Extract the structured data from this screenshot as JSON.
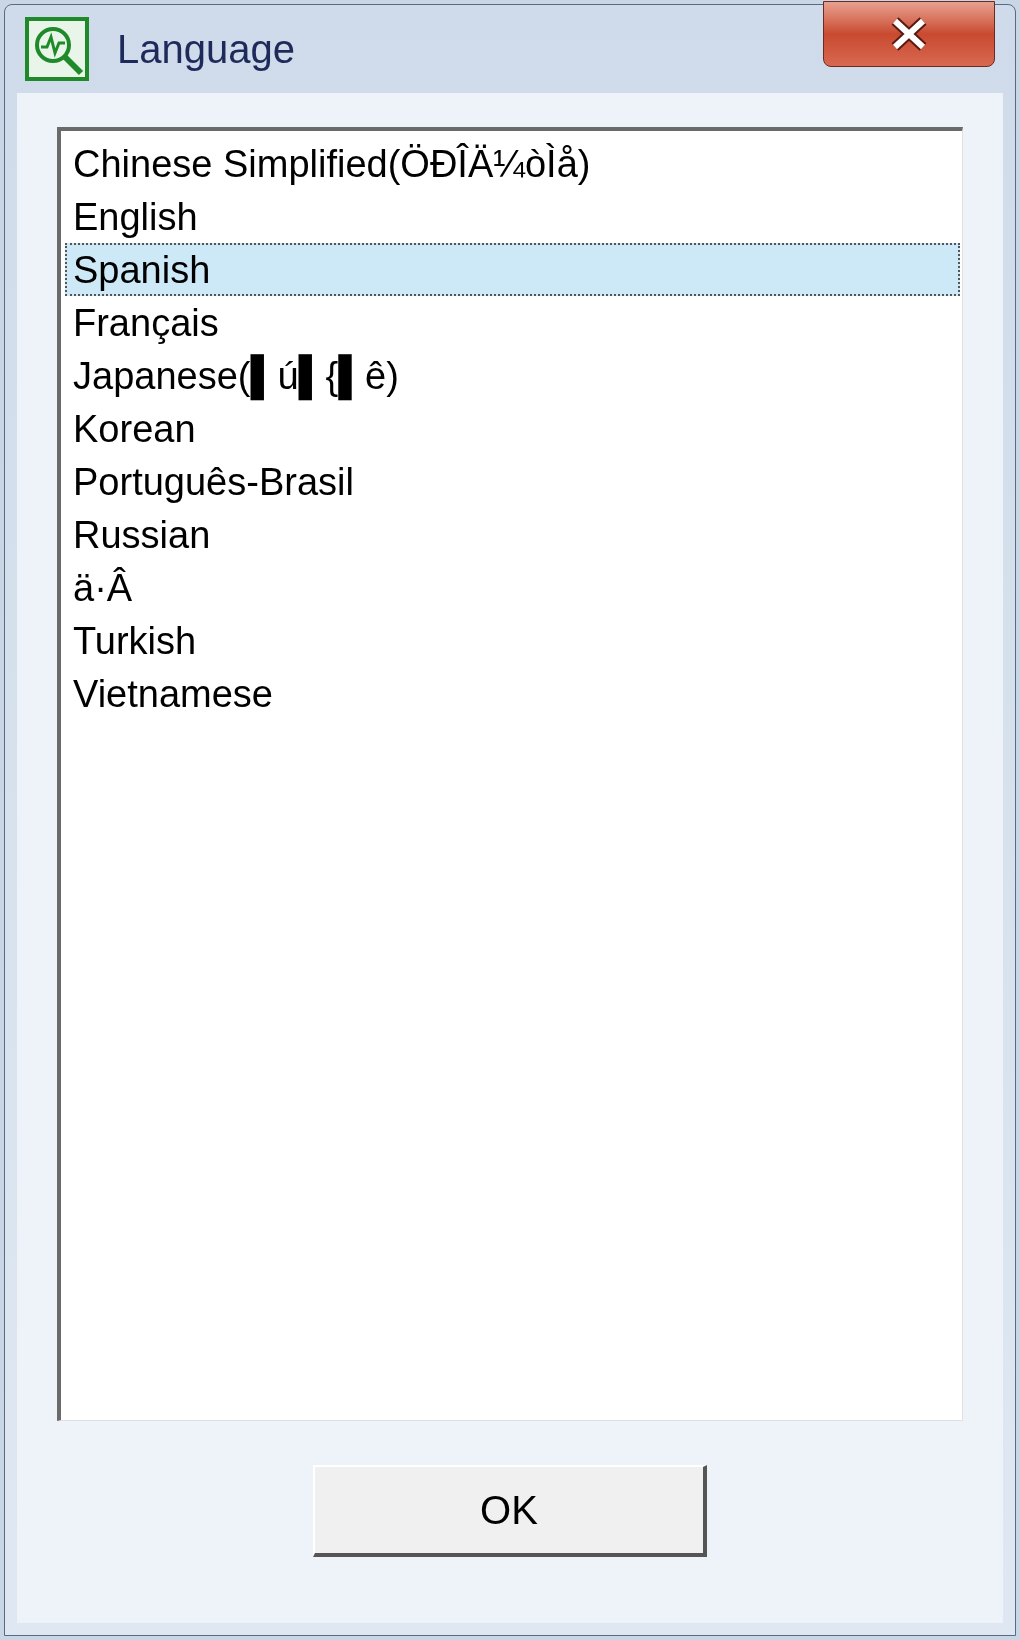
{
  "window": {
    "title": "Language"
  },
  "languages": [
    {
      "label": "Chinese Simplified(ÖÐÎÄ¼òÌå)",
      "selected": false
    },
    {
      "label": "English",
      "selected": false
    },
    {
      "label": "Spanish",
      "selected": true
    },
    {
      "label": "Français",
      "selected": false
    },
    {
      "label": "Japanese(▌ú▌{▌ê)",
      "selected": false
    },
    {
      "label": "Korean",
      "selected": false
    },
    {
      "label": "Português-Brasil",
      "selected": false
    },
    {
      "label": "Russian",
      "selected": false
    },
    {
      "label": "ä·Â",
      "selected": false
    },
    {
      "label": "Turkish",
      "selected": false
    },
    {
      "label": "Vietnamese",
      "selected": false
    }
  ],
  "buttons": [
    "OK"
  ]
}
